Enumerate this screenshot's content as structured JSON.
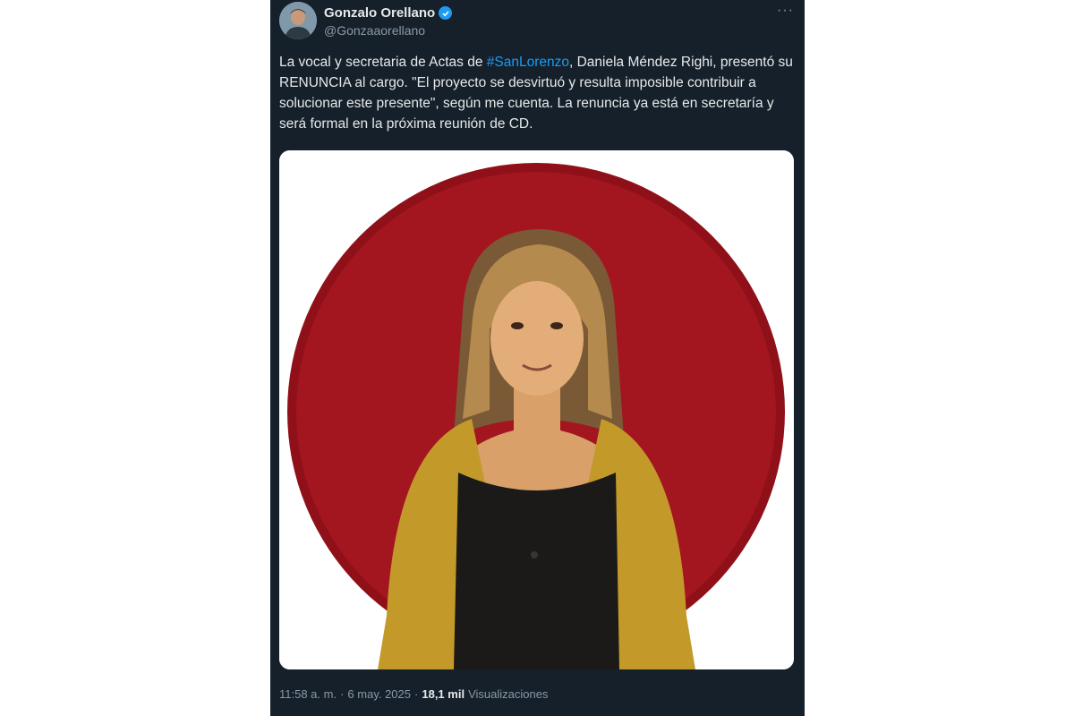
{
  "tweet": {
    "author": {
      "name": "Gonzalo Orellano",
      "handle": "@Gonzaaorellano",
      "verified": true,
      "avatar_icon": "profile-photo"
    },
    "menu_icon": "more-horizontal-icon",
    "text": {
      "part1": "La vocal y secretaria de Actas de ",
      "hashtag": "#SanLorenzo",
      "part2": ", Daniela Méndez Righi, presentó su RENUNCIA al cargo. \"El proyecto se desvirtuó y resulta imposible contribuir a solucionar este presente\", según me cuenta. La renuncia ya está en secretaría y será formal en la próxima reunión de CD."
    },
    "media": {
      "kind": "photo",
      "description_icon": "portrait-photo"
    },
    "meta": {
      "time": "11:58 a. m.",
      "sep1": "·",
      "date": "6 may. 2025",
      "sep2": "·",
      "views_count": "18,1 mil",
      "views_label": "Visualizaciones"
    }
  },
  "colors": {
    "background": "#15202b",
    "text": "#e7e9ea",
    "secondary": "#8b98a5",
    "accent": "#1d9bf0",
    "circle_red": "#a3161f"
  }
}
